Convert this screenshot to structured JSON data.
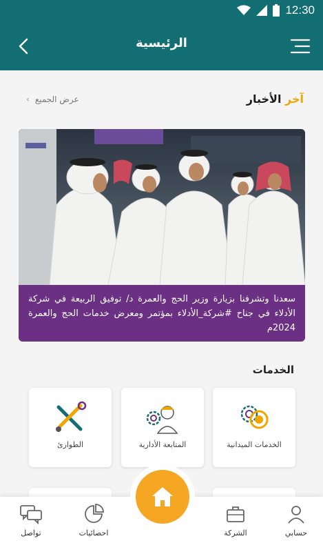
{
  "status_bar": {
    "time": "12:30"
  },
  "app_bar": {
    "title": "الرئيسية"
  },
  "news": {
    "title_prefix": "آخر ",
    "title_suffix": "الأخبار",
    "view_all": "عرض الجميع",
    "caption": "سعدنا وتشرفنا بزيارة وزير الحج والعمرة د/ توفيق الربيعة في شركة الأدلاء في جناح #شركة_الأدلاء بمؤتمر ومعرض خدمات الحج والعمرة 2024م"
  },
  "services": {
    "title": "الخدمات",
    "items": [
      {
        "label": "الخدمات الميدانية",
        "icon": "field-services-icon"
      },
      {
        "label": "المتابعة الأدارية",
        "icon": "admin-followup-icon"
      },
      {
        "label": "الطوارئ",
        "icon": "emergency-tools-icon"
      }
    ]
  },
  "bottom_nav": {
    "items": [
      {
        "label": "حسابي",
        "icon": "user-icon"
      },
      {
        "label": "الشركة",
        "icon": "briefcase-icon"
      },
      {
        "label": "احصائيات",
        "icon": "pie-chart-icon"
      },
      {
        "label": "تواصل",
        "icon": "chat-icon"
      }
    ],
    "home_icon": "home-icon"
  },
  "colors": {
    "primary": "#136e74",
    "accent": "#f0a500",
    "caption_bg": "#6b2f83",
    "fab": "#f5a623"
  }
}
